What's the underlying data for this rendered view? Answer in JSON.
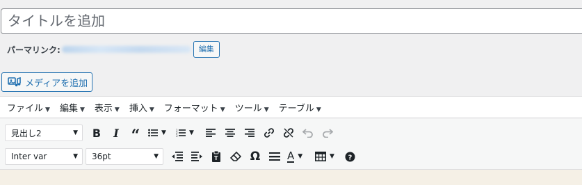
{
  "title": {
    "placeholder": "タイトルを追加"
  },
  "permalink": {
    "label": "パーマリンク:",
    "edit_label": "編集"
  },
  "media": {
    "add_label": "メディアを追加"
  },
  "menubar": [
    {
      "label": "ファイル"
    },
    {
      "label": "編集"
    },
    {
      "label": "表示"
    },
    {
      "label": "挿入"
    },
    {
      "label": "フォーマット"
    },
    {
      "label": "ツール"
    },
    {
      "label": "テーブル"
    }
  ],
  "toolbar": {
    "format_select": "見出し2",
    "font_family_select": "Inter var",
    "font_size_select": "36pt",
    "icons_row1": [
      "bold-icon",
      "italic-icon",
      "blockquote-icon",
      "bullet-list-icon",
      "numbered-list-icon",
      "align-left-icon",
      "align-center-icon",
      "align-right-icon",
      "link-icon",
      "unlink-icon",
      "undo-icon",
      "redo-icon"
    ],
    "icons_row2": [
      "outdent-icon",
      "indent-icon",
      "paste-text-icon",
      "clear-formatting-icon",
      "special-character-icon",
      "horizontal-line-icon",
      "text-color-icon",
      "table-icon",
      "help-icon"
    ]
  },
  "colors": {
    "accent": "#2271b1",
    "editor_bg": "#f5f0e6",
    "page_bg": "#f0f0f1"
  }
}
